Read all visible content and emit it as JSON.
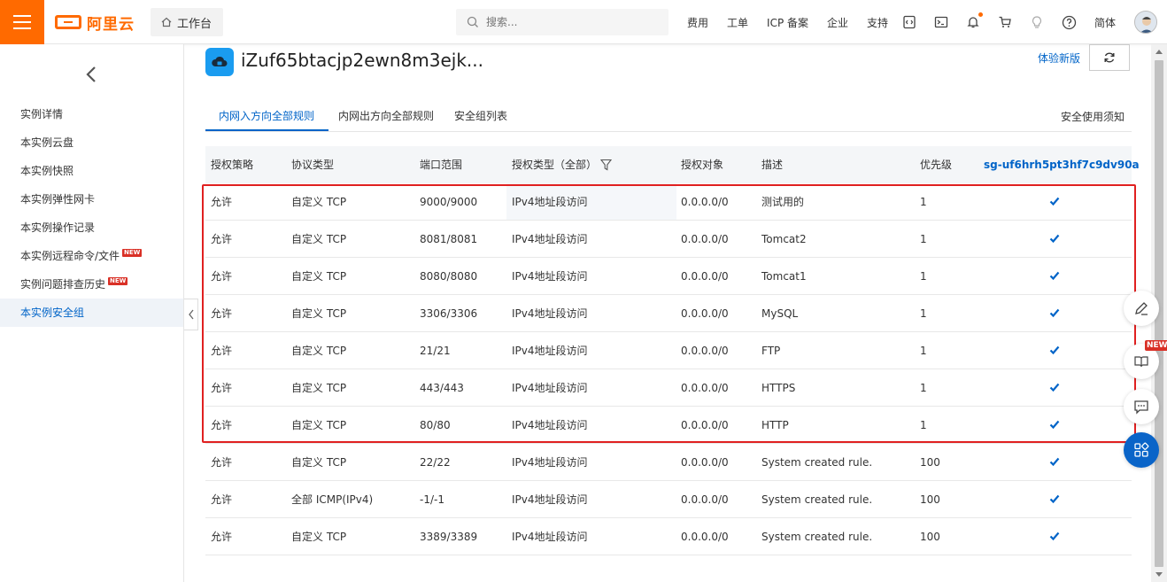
{
  "topbar": {
    "logo_text": "阿里云",
    "workbench_label": "工作台",
    "search_placeholder": "搜索...",
    "nav_links": [
      "费用",
      "工单",
      "ICP 备案",
      "企业",
      "支持"
    ],
    "language": "简体",
    "icons": [
      "code-icon",
      "terminal-icon",
      "bell-icon",
      "cart-icon",
      "lightbulb-icon",
      "help-icon"
    ]
  },
  "sidebar": {
    "items": [
      {
        "label": "实例详情",
        "active": false,
        "new": false
      },
      {
        "label": "本实例云盘",
        "active": false,
        "new": false
      },
      {
        "label": "本实例快照",
        "active": false,
        "new": false
      },
      {
        "label": "本实例弹性网卡",
        "active": false,
        "new": false
      },
      {
        "label": "本实例操作记录",
        "active": false,
        "new": false
      },
      {
        "label": "本实例远程命令/文件",
        "active": false,
        "new": true
      },
      {
        "label": "实例问题排查历史",
        "active": false,
        "new": true
      },
      {
        "label": "本实例安全组",
        "active": true,
        "new": false
      }
    ],
    "new_tag": "NEW"
  },
  "main": {
    "instance_title": "iZuf65btacjp2ewn8m3ejk...",
    "try_new_label": "体验新版",
    "tabs": [
      "内网入方向全部规则",
      "内网出方向全部规则",
      "安全组列表"
    ],
    "notice_label": "安全使用须知"
  },
  "table": {
    "headers": [
      "授权策略",
      "协议类型",
      "端口范围",
      "授权类型（全部）",
      "授权对象",
      "描述",
      "优先级",
      "sg-uf6hrh5pt3hf7c9dv90a"
    ],
    "rows": [
      [
        "允许",
        "自定义 TCP",
        "9000/9000",
        "IPv4地址段访问",
        "0.0.0.0/0",
        "测试用的",
        "1"
      ],
      [
        "允许",
        "自定义 TCP",
        "8081/8081",
        "IPv4地址段访问",
        "0.0.0.0/0",
        "Tomcat2",
        "1"
      ],
      [
        "允许",
        "自定义 TCP",
        "8080/8080",
        "IPv4地址段访问",
        "0.0.0.0/0",
        "Tomcat1",
        "1"
      ],
      [
        "允许",
        "自定义 TCP",
        "3306/3306",
        "IPv4地址段访问",
        "0.0.0.0/0",
        "MySQL",
        "1"
      ],
      [
        "允许",
        "自定义 TCP",
        "21/21",
        "IPv4地址段访问",
        "0.0.0.0/0",
        "FTP",
        "1"
      ],
      [
        "允许",
        "自定义 TCP",
        "443/443",
        "IPv4地址段访问",
        "0.0.0.0/0",
        "HTTPS",
        "1"
      ],
      [
        "允许",
        "自定义 TCP",
        "80/80",
        "IPv4地址段访问",
        "0.0.0.0/0",
        "HTTP",
        "1"
      ],
      [
        "允许",
        "自定义 TCP",
        "22/22",
        "IPv4地址段访问",
        "0.0.0.0/0",
        "System created rule.",
        "100"
      ],
      [
        "允许",
        "全部 ICMP(IPv4)",
        "-1/-1",
        "IPv4地址段访问",
        "0.0.0.0/0",
        "System created rule.",
        "100"
      ],
      [
        "允许",
        "自定义 TCP",
        "3389/3389",
        "IPv4地址段访问",
        "0.0.0.0/0",
        "System created rule.",
        "100"
      ]
    ]
  },
  "floating": {
    "new_badge": "NEW"
  },
  "colors": {
    "brand": "#ff6a00",
    "link": "#0064c8",
    "highlight_border": "#e02020"
  }
}
